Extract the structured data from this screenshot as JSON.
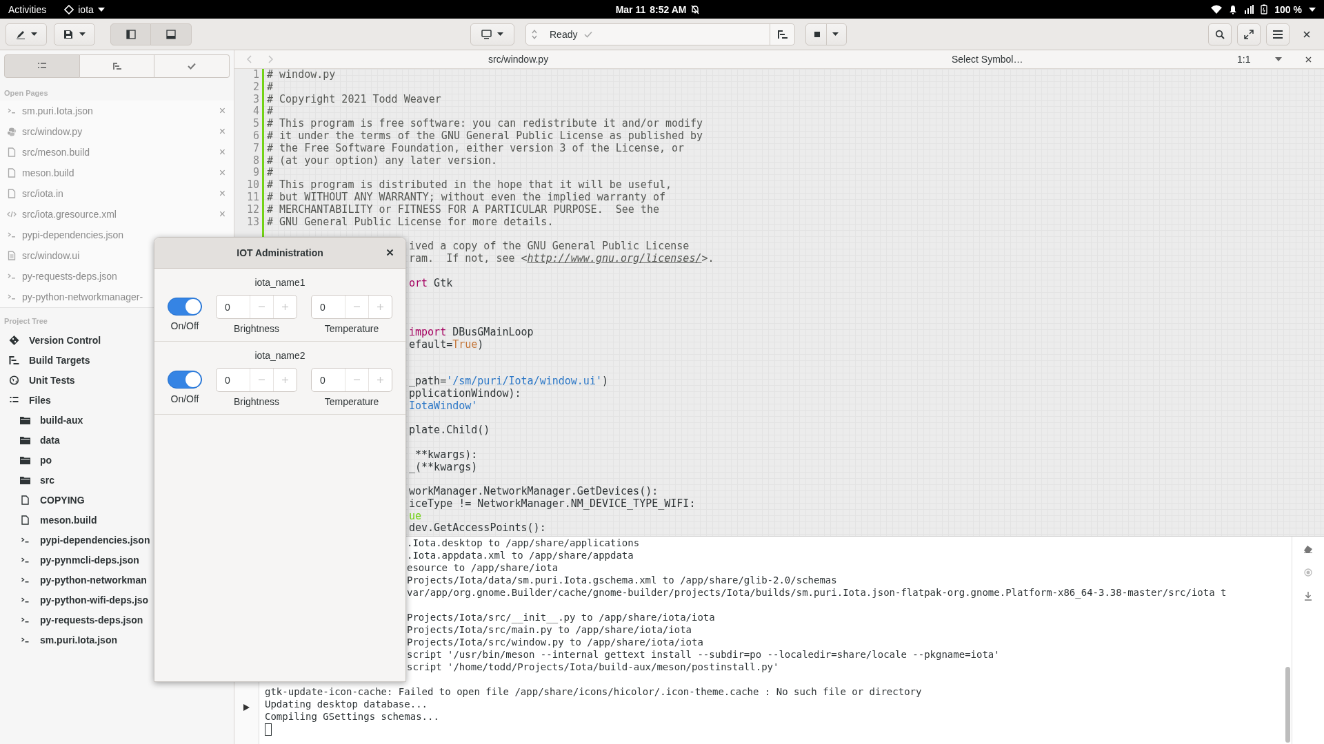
{
  "top_bar": {
    "activities": "Activities",
    "app_menu": "iota",
    "date": "Mar 11",
    "time": "8:52 AM",
    "battery": "100 %"
  },
  "header_bar": {
    "panel_toggles": [
      {
        "kind": "left",
        "active": true
      },
      {
        "kind": "bottom",
        "active": true
      }
    ],
    "build_status": "Ready"
  },
  "sidebar": {
    "tabs": [
      {
        "kind": "list",
        "selected": true
      },
      {
        "kind": "targets",
        "selected": false
      },
      {
        "kind": "check",
        "selected": false
      }
    ],
    "open_pages_title": "Open Pages",
    "open_pages": [
      {
        "kind": "json",
        "label": "sm.puri.Iota.json",
        "close": "×"
      },
      {
        "kind": "python",
        "label": "src/window.py",
        "close": "×"
      },
      {
        "kind": "file",
        "label": "src/meson.build",
        "close": "×"
      },
      {
        "kind": "file",
        "label": "meson.build",
        "close": "×"
      },
      {
        "kind": "file",
        "label": "src/iota.in",
        "close": "×"
      },
      {
        "kind": "xml",
        "label": "src/iota.gresource.xml",
        "close": "×"
      },
      {
        "kind": "json",
        "label": "pypi-dependencies.json"
      },
      {
        "kind": "doc",
        "label": "src/window.ui"
      },
      {
        "kind": "json",
        "label": "py-requests-deps.json"
      },
      {
        "kind": "json",
        "label": "py-python-networkmanager-"
      }
    ],
    "project_tree_title": "Project Tree",
    "project_tree": [
      {
        "kind": "git",
        "label": "Version Control"
      },
      {
        "kind": "targets",
        "label": "Build Targets"
      },
      {
        "kind": "tests",
        "label": "Unit Tests"
      },
      {
        "kind": "files",
        "label": "Files",
        "children": [
          {
            "kind": "folder",
            "label": "build-aux"
          },
          {
            "kind": "folder",
            "label": "data"
          },
          {
            "kind": "folder",
            "label": "po"
          },
          {
            "kind": "folder",
            "label": "src"
          },
          {
            "kind": "file",
            "label": "COPYING"
          },
          {
            "kind": "file",
            "label": "meson.build"
          },
          {
            "kind": "json",
            "label": "pypi-dependencies.json"
          },
          {
            "kind": "json",
            "label": "py-pynmcli-deps.json"
          },
          {
            "kind": "json",
            "label": "py-python-networkman"
          },
          {
            "kind": "json",
            "label": "py-python-wifi-deps.jso"
          },
          {
            "kind": "json",
            "label": "py-requests-deps.json"
          },
          {
            "kind": "json",
            "label": "sm.puri.Iota.json"
          }
        ]
      }
    ]
  },
  "editor": {
    "file": "src/window.py",
    "symbol": "Select Symbol…",
    "position": "1:1",
    "lines": [
      {
        "kind": "code",
        "number": "1",
        "segments": [
          {
            "kind": "comment",
            "text": "# window.py"
          }
        ]
      },
      {
        "kind": "code",
        "number": "2",
        "segments": [
          {
            "kind": "comment",
            "text": "#"
          }
        ]
      },
      {
        "kind": "code",
        "number": "3",
        "segments": [
          {
            "kind": "comment",
            "text": "# Copyright 2021 Todd Weaver"
          }
        ]
      },
      {
        "kind": "code",
        "number": "4",
        "segments": [
          {
            "kind": "comment",
            "text": "#"
          }
        ]
      },
      {
        "kind": "code",
        "number": "5",
        "segments": [
          {
            "kind": "comment",
            "text": "# This program is free software: you can redistribute it and/or modify"
          }
        ]
      },
      {
        "kind": "code",
        "number": "6",
        "segments": [
          {
            "kind": "comment",
            "text": "# it under the terms of the GNU General Public License as published by"
          }
        ]
      },
      {
        "kind": "code",
        "number": "7",
        "segments": [
          {
            "kind": "comment",
            "text": "# the Free Software Foundation, either version 3 of the License, or"
          }
        ]
      },
      {
        "kind": "code",
        "number": "8",
        "segments": [
          {
            "kind": "comment",
            "text": "# (at your option) any later version."
          }
        ]
      },
      {
        "kind": "code",
        "number": "9",
        "segments": [
          {
            "kind": "comment",
            "text": "#"
          }
        ]
      },
      {
        "kind": "code",
        "number": "10",
        "segments": [
          {
            "kind": "comment",
            "text": "# This program is distributed in the hope that it will be useful,"
          }
        ]
      },
      {
        "kind": "code",
        "number": "11",
        "segments": [
          {
            "kind": "comment",
            "text": "# but WITHOUT ANY WARRANTY; without even the implied warranty of"
          }
        ]
      },
      {
        "kind": "code",
        "number": "12",
        "segments": [
          {
            "kind": "comment",
            "text": "# MERCHANTABILITY or FITNESS FOR A PARTICULAR PURPOSE.  See the"
          }
        ]
      },
      {
        "kind": "code",
        "number": "13",
        "segments": [
          {
            "kind": "comment",
            "text": "# GNU General Public License for more details."
          }
        ]
      },
      {
        "kind": "blank"
      },
      {
        "kind": "fragment",
        "segments": [
          {
            "kind": "comment",
            "text": "ived a copy of the GNU General Public License"
          }
        ]
      },
      {
        "kind": "fragment",
        "segments": [
          {
            "kind": "comment",
            "text": "ram.  If not, see <"
          },
          {
            "kind": "link",
            "text": "http://www.gnu.org/licenses/"
          },
          {
            "kind": "comment",
            "text": ">."
          }
        ]
      },
      {
        "kind": "blank"
      },
      {
        "kind": "fragment",
        "segments": [
          {
            "kind": "keyword",
            "text": "ort"
          },
          {
            "kind": "plain",
            "text": " Gtk"
          }
        ]
      },
      {
        "kind": "blank"
      },
      {
        "kind": "blank"
      },
      {
        "kind": "blank"
      },
      {
        "kind": "fragment",
        "segments": [
          {
            "kind": "keyword",
            "text": "import"
          },
          {
            "kind": "plain",
            "text": " DBusGMainLoop"
          }
        ]
      },
      {
        "kind": "fragment",
        "segments": [
          {
            "kind": "plain",
            "text": "efault="
          },
          {
            "kind": "constant",
            "text": "True"
          },
          {
            "kind": "plain",
            "text": ")"
          }
        ]
      },
      {
        "kind": "blank"
      },
      {
        "kind": "blank"
      },
      {
        "kind": "fragment",
        "segments": [
          {
            "kind": "plain",
            "text": "_path="
          },
          {
            "kind": "string",
            "text": "'/sm/puri/Iota/window.ui'"
          },
          {
            "kind": "plain",
            "text": ")"
          }
        ]
      },
      {
        "kind": "fragment",
        "segments": [
          {
            "kind": "plain",
            "text": "pplicationWindow):"
          }
        ]
      },
      {
        "kind": "fragment",
        "segments": [
          {
            "kind": "string",
            "text": "IotaWindow'"
          }
        ]
      },
      {
        "kind": "blank"
      },
      {
        "kind": "fragment",
        "segments": [
          {
            "kind": "plain",
            "text": "plate.Child()"
          }
        ]
      },
      {
        "kind": "blank"
      },
      {
        "kind": "fragment",
        "segments": [
          {
            "kind": "plain",
            "text": " **kwargs):"
          }
        ]
      },
      {
        "kind": "fragment",
        "segments": [
          {
            "kind": "plain",
            "text": "_(**kwargs)"
          }
        ]
      },
      {
        "kind": "blank"
      },
      {
        "kind": "fragment",
        "segments": [
          {
            "kind": "plain",
            "text": "workManager.NetworkManager.GetDevices():"
          }
        ]
      },
      {
        "kind": "fragment",
        "segments": [
          {
            "kind": "plain",
            "text": "iceType != NetworkManager.NM_DEVICE_TYPE_WIFI:"
          }
        ]
      },
      {
        "kind": "fragment",
        "segments": [
          {
            "kind": "builtin",
            "text": "ue"
          }
        ]
      },
      {
        "kind": "fragment",
        "segments": [
          {
            "kind": "plain",
            "text": "dev.GetAccessPoints():"
          }
        ]
      }
    ]
  },
  "terminal": {
    "lines": [
      {
        "kind": "fragment",
        "text": ".Iota.desktop to /app/share/applications"
      },
      {
        "kind": "fragment",
        "text": ".Iota.appdata.xml to /app/share/appdata"
      },
      {
        "kind": "fragment",
        "text": "esource to /app/share/iota"
      },
      {
        "kind": "fragment",
        "text": "Projects/Iota/data/sm.puri.Iota.gschema.xml to /app/share/glib-2.0/schemas"
      },
      {
        "kind": "fragment",
        "text": "var/app/org.gnome.Builder/cache/gnome-builder/projects/Iota/builds/sm.puri.Iota.json-flatpak-org.gnome.Platform-x86_64-3.38-master/src/iota t"
      },
      {
        "kind": "blank"
      },
      {
        "kind": "fragment",
        "text": "Projects/Iota/src/__init__.py to /app/share/iota/iota"
      },
      {
        "kind": "fragment",
        "text": "Projects/Iota/src/main.py to /app/share/iota/iota"
      },
      {
        "kind": "fragment",
        "text": "Projects/Iota/src/window.py to /app/share/iota/iota"
      },
      {
        "kind": "fragment",
        "text": "script '/usr/bin/meson --internal gettext install --subdir=po --localedir=share/locale --pkgname=iota'"
      },
      {
        "kind": "fragment",
        "text": "script '/home/todd/Projects/Iota/build-aux/meson/postinstall.py'"
      },
      {
        "kind": "blank"
      },
      {
        "kind": "full",
        "text": "gtk-update-icon-cache: Failed to open file /app/share/icons/hicolor/.icon-theme.cache : No such file or directory"
      },
      {
        "kind": "full",
        "text": "Updating desktop database..."
      },
      {
        "kind": "full",
        "text": "Compiling GSettings schemas..."
      }
    ]
  },
  "dialog": {
    "title": "IOT Administration",
    "devices": [
      {
        "name": "iota_name1",
        "switch_label": "On/Off",
        "on": true,
        "spinners": [
          {
            "value": "0",
            "label": "Brightness"
          },
          {
            "value": "0",
            "label": "Temperature"
          }
        ]
      },
      {
        "name": "iota_name2",
        "switch_label": "On/Off",
        "on": true,
        "spinners": [
          {
            "value": "0",
            "label": "Brightness"
          },
          {
            "value": "0",
            "label": "Temperature"
          }
        ]
      }
    ]
  }
}
